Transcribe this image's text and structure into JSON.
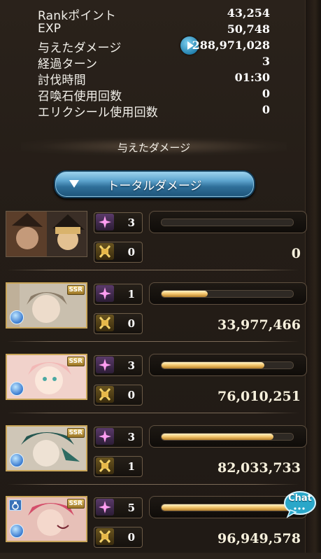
{
  "stats": [
    {
      "label": "Rankポイント",
      "value": "43,254"
    },
    {
      "label": "EXP",
      "value": "50,748"
    },
    {
      "label": "与えたダメージ",
      "value": "288,971,028"
    },
    {
      "label": "経過ターン",
      "value": "3"
    },
    {
      "label": "討伐時間",
      "value": "01:30"
    },
    {
      "label": "召喚石使用回数",
      "value": "0"
    },
    {
      "label": "エリクシール使用回数",
      "value": "0"
    }
  ],
  "section_title": "与えたダメージ",
  "total_button_label": "トータルダメージ",
  "characters": [
    {
      "star_count": "3",
      "cross_count": "0",
      "damage": "0",
      "bar_fill": 0.0,
      "rarity": "",
      "portrait_colors": [
        "#6b4a32",
        "#d7b07a"
      ]
    },
    {
      "star_count": "1",
      "cross_count": "0",
      "damage": "33,977,466",
      "bar_fill": 0.35,
      "rarity": "SSR",
      "portrait_colors": [
        "#d6cfbf",
        "#8b7d6a"
      ]
    },
    {
      "star_count": "3",
      "cross_count": "0",
      "damage": "76,010,251",
      "bar_fill": 0.78,
      "rarity": "SSR",
      "portrait_colors": [
        "#f0c9c4",
        "#e8d6c2"
      ]
    },
    {
      "star_count": "3",
      "cross_count": "1",
      "damage": "82,033,733",
      "bar_fill": 0.85,
      "rarity": "SSR",
      "portrait_colors": [
        "#2f5a55",
        "#d8cdbd"
      ]
    },
    {
      "star_count": "5",
      "cross_count": "0",
      "damage": "96,949,578",
      "bar_fill": 1.0,
      "rarity": "SSR",
      "portrait_colors": [
        "#d95e74",
        "#f0b9b3"
      ]
    }
  ],
  "chat_label": "Chat",
  "colors": {
    "accent_blue": "#2f6f99",
    "bar_gold": "#f2c46b",
    "frame_gold": "#c9a65a"
  }
}
